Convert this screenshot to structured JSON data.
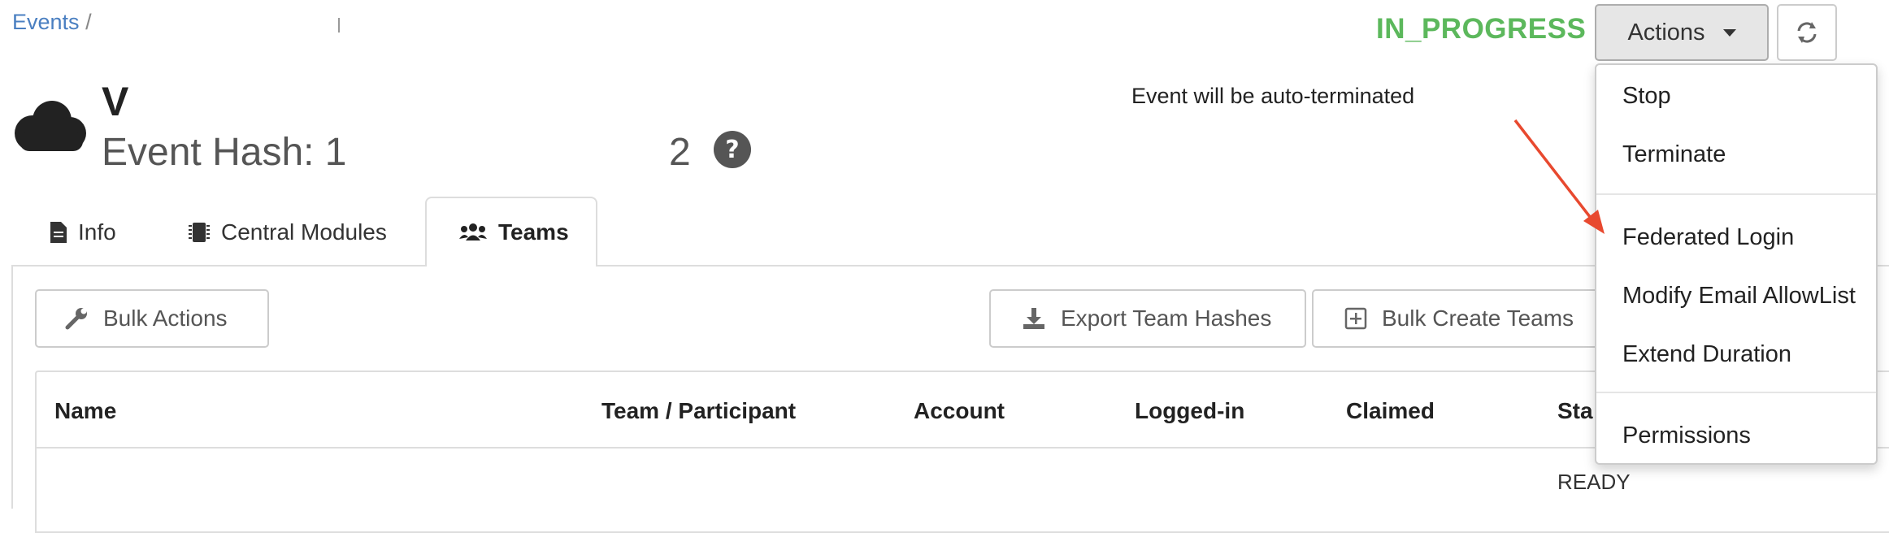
{
  "breadcrumb": {
    "events_link": "Events",
    "separator": "/"
  },
  "status": {
    "label": "IN_PROGRESS",
    "color": "#5cb85c"
  },
  "actions_button": {
    "label": "Actions"
  },
  "header": {
    "event_name": "V",
    "event_hash_label": "Event Hash: 1",
    "event_hash_suffix": "2",
    "auto_terminate_notice": "Event will be auto-terminated"
  },
  "tabs": [
    {
      "label": "Info",
      "icon": "file-icon"
    },
    {
      "label": "Central Modules",
      "icon": "chip-icon"
    },
    {
      "label": "Teams",
      "icon": "users-icon",
      "active": true
    }
  ],
  "toolbar": {
    "bulk_actions": "Bulk Actions",
    "export_team_hashes": "Export Team Hashes",
    "bulk_create_teams": "Bulk Create Teams"
  },
  "table": {
    "columns": [
      "Name",
      "Team / Participant",
      "Account",
      "Logged-in",
      "Claimed",
      "Sta"
    ],
    "rows": [
      {
        "status": "READY"
      }
    ]
  },
  "dropdown": {
    "items": [
      "Stop",
      "Terminate",
      "Federated Login",
      "Modify Email AllowList",
      "Extend Duration",
      "Permissions"
    ]
  },
  "colors": {
    "link": "#4a7fc1",
    "annotation_arrow": "#e8492f"
  }
}
